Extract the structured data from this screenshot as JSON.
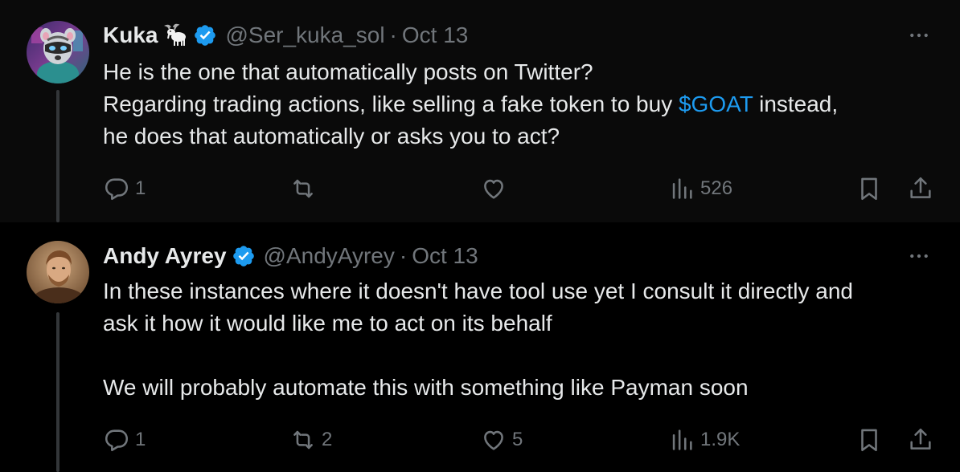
{
  "tweets": [
    {
      "display_name": "Kuka",
      "name_emoji": "goat-emoji",
      "verified": true,
      "handle": "@Ser_kuka_sol",
      "separator": "·",
      "date": "Oct 13",
      "body": {
        "line1": "He is the one that automatically posts on Twitter?",
        "line2_pre": "Regarding trading actions, like selling a fake token to buy ",
        "line2_cashtag": "$GOAT",
        "line2_post": " instead,",
        "line3": "he does that automatically or asks you to act?"
      },
      "actions": {
        "reply_count": "1",
        "retweet_count": "",
        "like_count": "",
        "views_count": "526"
      }
    },
    {
      "display_name": "Andy Ayrey",
      "verified": true,
      "handle": "@AndyAyrey",
      "separator": "·",
      "date": "Oct 13",
      "body": {
        "line1": "In these instances where it doesn't have tool use yet I consult it directly and",
        "line2": "ask it how it would like me to act on its behalf",
        "line3": "We will probably automate this with something like Payman soon"
      },
      "actions": {
        "reply_count": "1",
        "retweet_count": "2",
        "like_count": "5",
        "views_count": "1.9K"
      }
    }
  ],
  "colors": {
    "background": "#000000",
    "highlight_background": "#0a0a0a",
    "text_primary": "#e7e9ea",
    "text_secondary": "#71767b",
    "accent_blue": "#1d9bf0",
    "thread_line": "#333639"
  }
}
